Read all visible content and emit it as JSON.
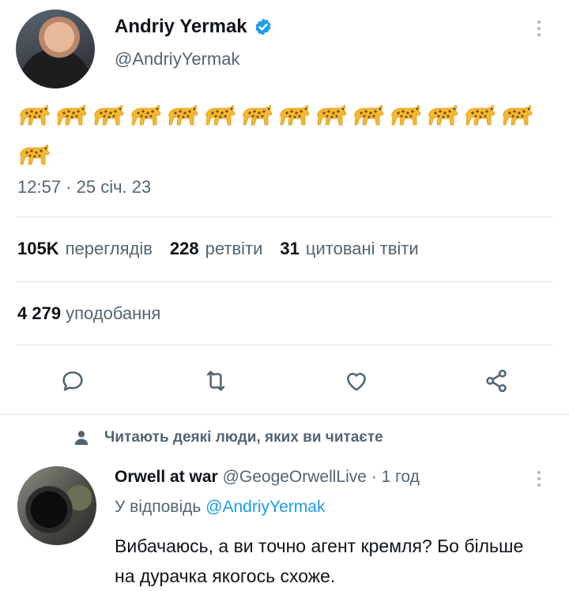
{
  "tweet": {
    "author_name": "Andriy Yermak",
    "author_handle": "@AndriyYermak",
    "emoji_count_line1": 14,
    "emoji_count_line2": 1,
    "emoji_name": "leopard-emoji",
    "timestamp": "12:57 · 25 січ. 23",
    "stats": {
      "views_value": "105K",
      "views_label": "переглядів",
      "retweets_value": "228",
      "retweets_label": "ретвіти",
      "quotes_value": "31",
      "quotes_label": "цитовані твіти",
      "likes_value": "4 279",
      "likes_label": "уподобання"
    },
    "actions": [
      "reply-icon",
      "retweet-icon",
      "like-icon",
      "share-icon"
    ]
  },
  "social_context": {
    "text": "Читають деякі люди, яких ви читаєте"
  },
  "reply": {
    "author_name": "Orwell at war",
    "author_handle": "@GeogeOrwellLive",
    "time": "· 1 год",
    "replying_prefix": "У відповідь",
    "replying_to": "@AndriyYermak",
    "text": "Вибачаюсь, а ви точно агент кремля? Бо більше на дурачка якогось схоже."
  },
  "colors": {
    "accent": "#1d9bf0",
    "muted": "#536471",
    "text": "#0f1419",
    "leopard": "#f5b82e"
  }
}
